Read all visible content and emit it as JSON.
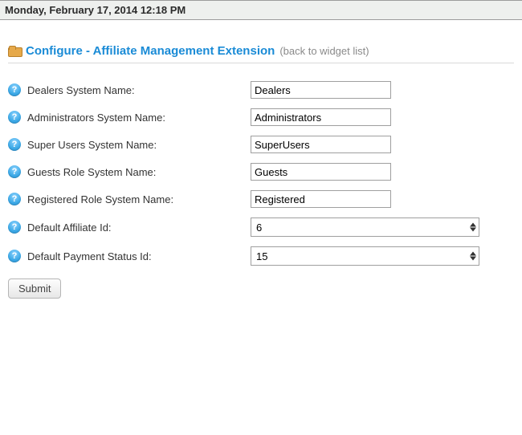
{
  "datebar": "Monday, February 17, 2014 12:18 PM",
  "title": "Configure - Affiliate Management Extension",
  "back_link": "(back to widget list)",
  "fields": {
    "dealers": {
      "label": "Dealers System Name:",
      "value": "Dealers"
    },
    "admins": {
      "label": "Administrators System Name:",
      "value": "Administrators"
    },
    "superusers": {
      "label": "Super Users System Name:",
      "value": "SuperUsers"
    },
    "guests": {
      "label": "Guests Role System Name:",
      "value": "Guests"
    },
    "registered": {
      "label": "Registered Role System Name:",
      "value": "Registered"
    },
    "default_aff": {
      "label": "Default Affiliate Id:",
      "value": "6"
    },
    "default_pay": {
      "label": "Default Payment Status Id:",
      "value": "15"
    }
  },
  "submit_label": "Submit"
}
